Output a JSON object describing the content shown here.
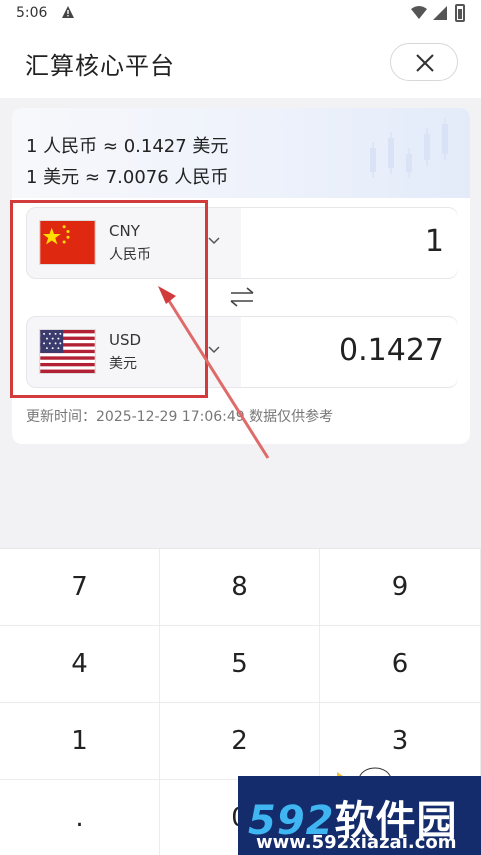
{
  "status_bar": {
    "time": "5:06"
  },
  "header": {
    "title": "汇算核心平台"
  },
  "rates": {
    "line1": "1 人民币 ≈ 0.1427 美元",
    "line2": "1 美元 ≈ 7.0076 人民币"
  },
  "from": {
    "code": "CNY",
    "name": "人民币",
    "amount": "1"
  },
  "to": {
    "code": "USD",
    "name": "美元",
    "amount": "0.1427"
  },
  "update_text": "更新时间：2025-12-29 17:06:49 数据仅供参考",
  "keypad": {
    "keys": [
      "7",
      "8",
      "9",
      "4",
      "5",
      "6",
      "1",
      "2",
      "3",
      ".",
      "0",
      ""
    ]
  },
  "watermark": {
    "brand_num": "592",
    "brand_cn": "软件园",
    "url": "www.592xiazai.com"
  },
  "colors": {
    "annotation_red": "#d23b3b",
    "watermark_bg": "#142c6b"
  }
}
